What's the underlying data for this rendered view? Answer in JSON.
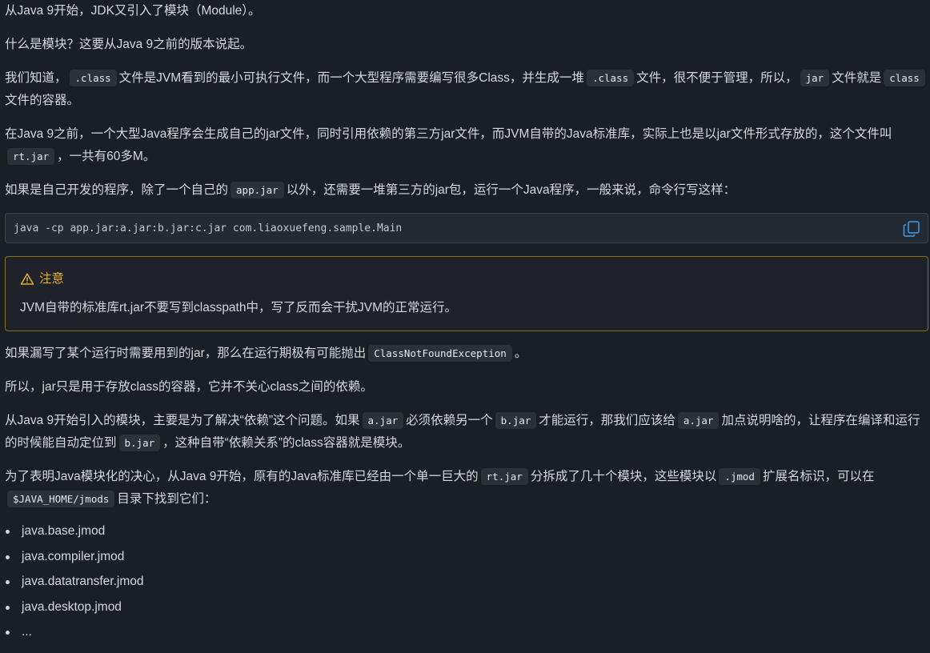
{
  "p1": "从Java 9开始，JDK又引入了模块（Module）。",
  "p2": "什么是模块？这要从Java 9之前的版本说起。",
  "p3": {
    "t1": "我们知道，",
    "c1": ".class",
    "t2": "文件是JVM看到的最小可执行文件，而一个大型程序需要编写很多Class，并生成一堆",
    "c2": ".class",
    "t3": "文件，很不便于管理，所以，",
    "c3": "jar",
    "t4": "文件就是",
    "c4": "class",
    "t5": "文件的容器。"
  },
  "p4": {
    "t1": "在Java 9之前，一个大型Java程序会生成自己的jar文件，同时引用依赖的第三方jar文件，而JVM自带的Java标准库，实际上也是以jar文件形式存放的，这个文件叫",
    "c1": "rt.jar",
    "t2": "，一共有60多M。"
  },
  "p5": {
    "t1": "如果是自己开发的程序，除了一个自己的",
    "c1": "app.jar",
    "t2": "以外，还需要一堆第三方的jar包，运行一个Java程序，一般来说，命令行写这样："
  },
  "codeblock": {
    "command": "java -cp app.jar:a.jar:b.jar:c.jar com.liaoxuefeng.sample.Main"
  },
  "note": {
    "title": "注意",
    "body": "JVM自带的标准库rt.jar不要写到classpath中，写了反而会干扰JVM的正常运行。",
    "accent": "#e0b033"
  },
  "p6": {
    "t1": "如果漏写了某个运行时需要用到的jar，那么在运行期极有可能抛出",
    "c1": "ClassNotFoundException",
    "t2": "。"
  },
  "p7": "所以，jar只是用于存放class的容器，它并不关心class之间的依赖。",
  "p8": {
    "t1": "从Java 9开始引入的模块，主要是为了解决“依赖”这个问题。如果",
    "c1": "a.jar",
    "t2": "必须依赖另一个",
    "c2": "b.jar",
    "t3": "才能运行，那我们应该给",
    "c3": "a.jar",
    "t4": "加点说明啥的，让程序在编译和运行的时候能自动定位到",
    "c4": "b.jar",
    "t5": "，这种自带“依赖关系”的class容器就是模块。"
  },
  "p9": {
    "t1": "为了表明Java模块化的决心，从Java 9开始，原有的Java标准库已经由一个单一巨大的",
    "c1": "rt.jar",
    "t2": "分拆成了几十个模块，这些模块以",
    "c2": ".jmod",
    "t3": "扩展名标识，可以在",
    "c3": "$JAVA_HOME/jmods",
    "t4": "目录下找到它们："
  },
  "modules": [
    "java.base.jmod",
    "java.compiler.jmod",
    "java.datatransfer.jmod",
    "java.desktop.jmod",
    "..."
  ]
}
